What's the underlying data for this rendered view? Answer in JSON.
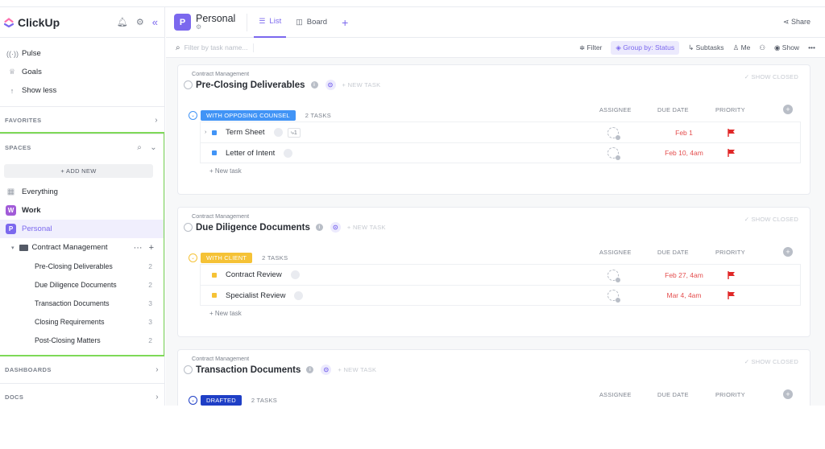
{
  "app": {
    "name": "ClickUp"
  },
  "sidebar": {
    "nav": [
      {
        "label": "Pulse",
        "icon": "pulse-icon",
        "glyph": "((·))"
      },
      {
        "label": "Goals",
        "icon": "trophy-icon",
        "glyph": "♕"
      },
      {
        "label": "Show less",
        "icon": "arrow-up-icon",
        "glyph": "↑"
      }
    ],
    "favorites_label": "FAVORITES",
    "spaces_label": "SPACES",
    "add_new_label": "+ ADD NEW",
    "spaces": [
      {
        "label": "Everything"
      },
      {
        "label": "Work",
        "badge": "W",
        "color": "#a15bd8"
      },
      {
        "label": "Personal",
        "badge": "P",
        "color": "#7b68ee"
      }
    ],
    "folder": {
      "label": "Contract Management"
    },
    "lists": [
      {
        "label": "Pre-Closing Deliverables",
        "count": "2"
      },
      {
        "label": "Due Diligence Documents",
        "count": "2"
      },
      {
        "label": "Transaction Documents",
        "count": "3"
      },
      {
        "label": "Closing Requirements",
        "count": "3"
      },
      {
        "label": "Post-Closing Matters",
        "count": "2"
      }
    ],
    "dashboards_label": "DASHBOARDS",
    "docs_label": "DOCS"
  },
  "header": {
    "space_badge": "P",
    "space_name": "Personal",
    "tabs": [
      {
        "label": "List",
        "active": true
      },
      {
        "label": "Board",
        "active": false
      }
    ],
    "share_label": "Share"
  },
  "toolbar": {
    "search_placeholder": "Filter by task name...",
    "filter_label": "Filter",
    "group_label": "Group by: Status",
    "subtasks_label": "Subtasks",
    "me_label": "Me",
    "show_label": "Show"
  },
  "columns": {
    "assignee": "ASSIGNEE",
    "due": "DUE DATE",
    "priority": "PRIORITY"
  },
  "lists": [
    {
      "crumb": "Contract Management",
      "title": "Pre-Closing Deliverables",
      "new_task": "+ NEW TASK",
      "show_closed": "✓ SHOW CLOSED",
      "status": "WITH OPPOSING COUNSEL",
      "status_color": "#4194f6",
      "task_count": "2 TASKS",
      "tasks": [
        {
          "name": "Term Sheet",
          "due": "Feb 1",
          "subtasks": "1"
        },
        {
          "name": "Letter of Intent",
          "due": "Feb 10, 4am"
        }
      ],
      "new_task_row": "+ New task"
    },
    {
      "crumb": "Contract Management",
      "title": "Due Diligence Documents",
      "new_task": "+ NEW TASK",
      "show_closed": "✓ SHOW CLOSED",
      "status": "WITH CLIENT",
      "status_color": "#f5c236",
      "task_count": "2 TASKS",
      "tasks": [
        {
          "name": "Contract Review",
          "due": "Feb 27, 4am"
        },
        {
          "name": "Specialist Review",
          "due": "Mar 4, 4am"
        }
      ],
      "new_task_row": "+ New task"
    },
    {
      "crumb": "Contract Management",
      "title": "Transaction Documents",
      "new_task": "+ NEW TASK",
      "show_closed": "✓ SHOW CLOSED",
      "status": "DRAFTED",
      "status_color": "#1f3fc6",
      "task_count": "2 TASKS"
    }
  ],
  "colors": {
    "accent": "#7b68ee",
    "highlight_border": "#7ed957",
    "flag": "#e02828",
    "due": "#e44e4e"
  }
}
